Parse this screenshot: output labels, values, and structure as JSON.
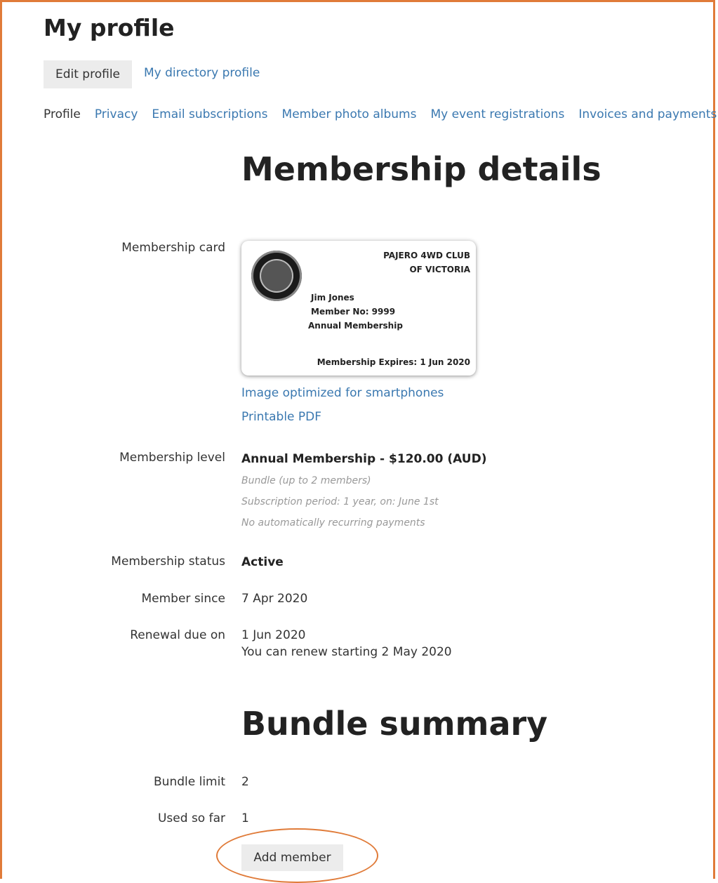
{
  "page": {
    "title": "My profile"
  },
  "tabs": {
    "active": "Edit profile",
    "other": "My directory profile"
  },
  "subnav": [
    "Profile",
    "Privacy",
    "Email subscriptions",
    "Member photo albums",
    "My event registrations",
    "Invoices and payments"
  ],
  "membership": {
    "heading": "Membership details",
    "card_label": "Membership card",
    "card": {
      "club_line1": "PAJERO 4WD CLUB",
      "club_line2": "OF VICTORIA",
      "name": "Jim Jones",
      "member_no": "Member No: 9999",
      "level": "Annual Membership",
      "expires": "Membership Expires: 1 Jun 2020"
    },
    "links": [
      "Image optimized for smartphones",
      "Printable PDF"
    ],
    "level_label": "Membership level",
    "level_value": "Annual Membership - $120.00 (AUD)",
    "level_notes": [
      "Bundle (up to 2 members)",
      "Subscription period: 1 year, on: June 1st",
      "No automatically recurring payments"
    ],
    "status_label": "Membership status",
    "status_value": "Active",
    "since_label": "Member since",
    "since_value": "7 Apr 2020",
    "renewal_label": "Renewal due on",
    "renewal_value": "1 Jun 2020",
    "renewal_note": "You can renew starting 2 May 2020"
  },
  "bundle": {
    "heading": "Bundle summary",
    "limit_label": "Bundle limit",
    "limit_value": "2",
    "used_label": "Used so far",
    "used_value": "1",
    "add_button": "Add member"
  },
  "colors": {
    "accent": "#e07b39",
    "link": "#3a78b0",
    "button_bg": "#ececec"
  }
}
